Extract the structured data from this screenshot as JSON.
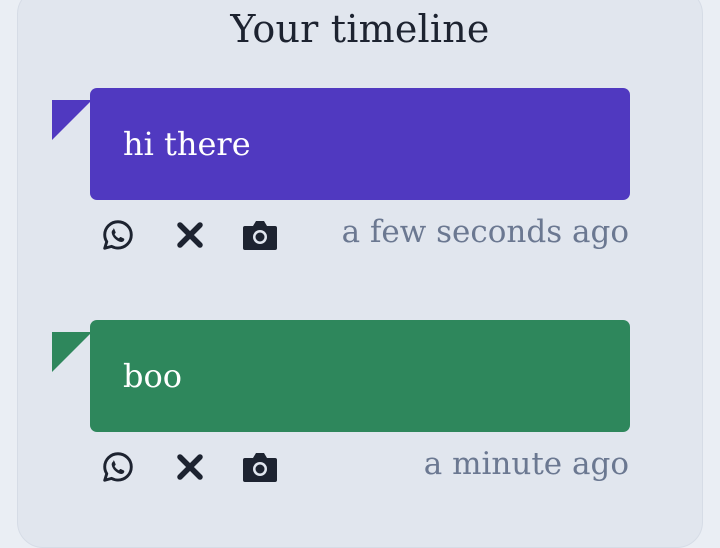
{
  "timeline": {
    "title": "Your timeline",
    "posts": [
      {
        "text": "hi there",
        "time": "a few seconds ago",
        "color": "#5039c0"
      },
      {
        "text": "boo",
        "time": "a minute ago",
        "color": "#2e875c"
      }
    ],
    "icons": [
      "whatsapp-icon",
      "close-icon",
      "camera-icon"
    ]
  }
}
